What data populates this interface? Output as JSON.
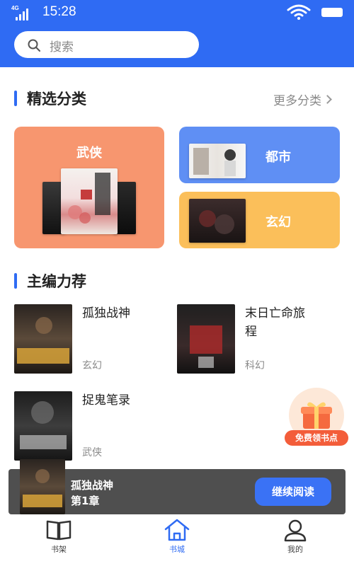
{
  "status_bar": {
    "time": "15:28",
    "network": "4G"
  },
  "search": {
    "placeholder": "搜索"
  },
  "featured_categories": {
    "title": "精选分类",
    "more_label": "更多分类",
    "cards": [
      {
        "label": "武侠",
        "color": "#f7966f"
      },
      {
        "label": "都市",
        "color": "#5f8ff4"
      },
      {
        "label": "玄幻",
        "color": "#fbbf5a"
      }
    ]
  },
  "editor_picks": {
    "title": "主编力荐",
    "books": [
      {
        "title": "孤独战神",
        "genre": "玄幻"
      },
      {
        "title": "末日亡命旅\n程",
        "genre": "科幻"
      },
      {
        "title": "捉鬼笔录",
        "genre": "武侠"
      }
    ]
  },
  "gift_badge": {
    "label": "免费领书点"
  },
  "continue_reading": {
    "book_title": "孤独战神",
    "chapter": "第1章",
    "button_label": "继续阅读"
  },
  "tab_bar": {
    "tabs": [
      {
        "label": "书架",
        "icon": "book-icon",
        "active": false
      },
      {
        "label": "书城",
        "icon": "home-icon",
        "active": true
      },
      {
        "label": "我的",
        "icon": "profile-icon",
        "active": false
      }
    ]
  },
  "colors": {
    "primary": "#2f6bf3",
    "wuxia_card": "#f7966f",
    "dushi_card": "#5f8ff4",
    "xuanhuan_card": "#fbbf5a",
    "gift_tag": "#f35d3a"
  }
}
